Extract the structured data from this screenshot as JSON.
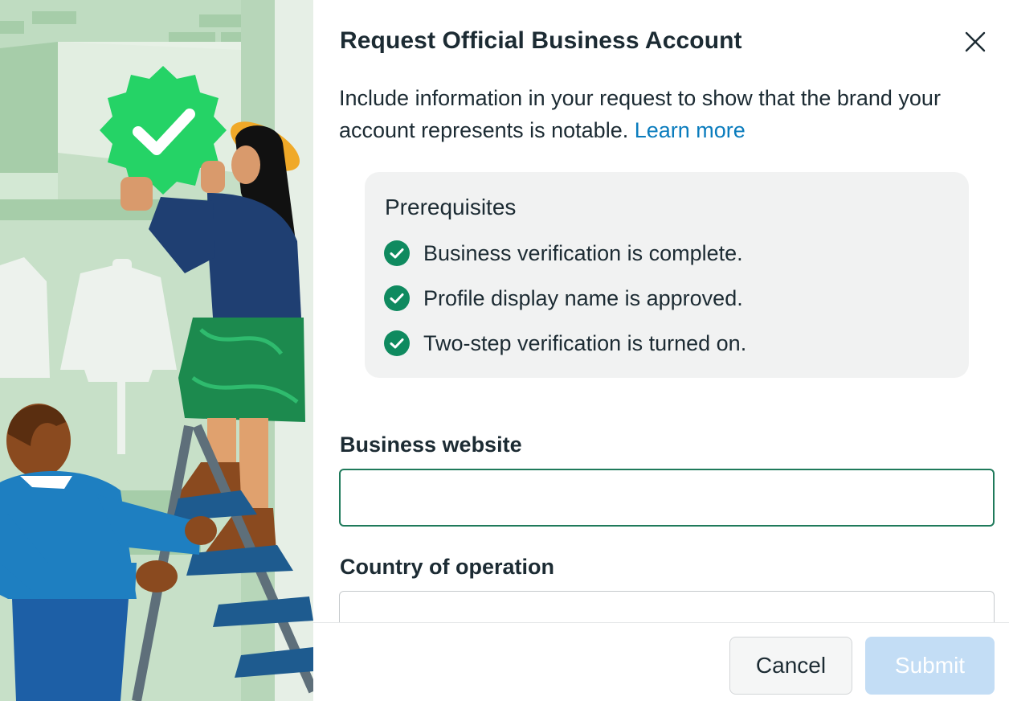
{
  "dialog": {
    "title": "Request Official Business Account",
    "intro_text": "Include information in your request to show that the brand your account represents is notable. ",
    "learn_more_link": "Learn more"
  },
  "prerequisites": {
    "title": "Prerequisites",
    "items": [
      {
        "label": "Business verification is complete.",
        "status": "complete"
      },
      {
        "label": "Profile display name is approved.",
        "status": "complete"
      },
      {
        "label": "Two-step verification is turned on.",
        "status": "complete"
      }
    ]
  },
  "form": {
    "website_label": "Business website",
    "website_value": "",
    "country_label": "Country of operation",
    "country_value": ""
  },
  "footer": {
    "cancel_label": "Cancel",
    "submit_label": "Submit"
  },
  "colors": {
    "accent_green": "#1f7a5b",
    "link_blue": "#0a7cbd",
    "submit_disabled": "#c3ddf5",
    "check_green": "#0f8a5f"
  },
  "icons": {
    "close": "close-icon",
    "check": "check-circle-icon",
    "verified_badge": "verified-badge-icon"
  }
}
